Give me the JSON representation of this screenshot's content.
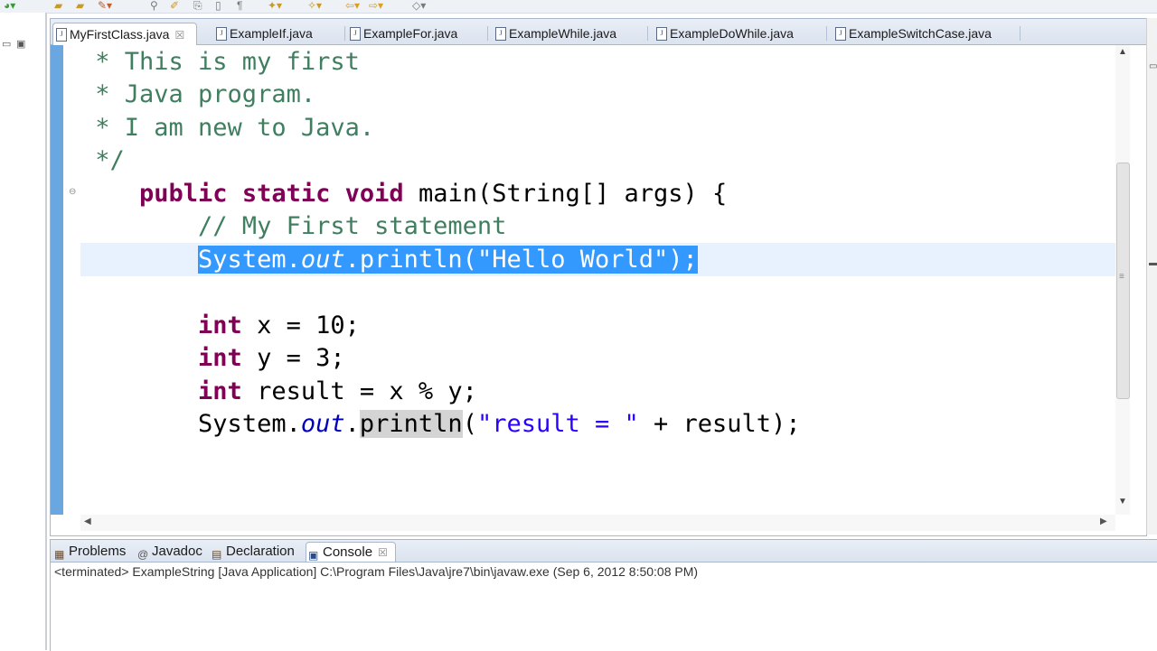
{
  "toolbar": {
    "icons": [
      "run-icon",
      "open-icon",
      "folder-icon",
      "wand-icon",
      "search-icon",
      "edit-icon",
      "paste-icon",
      "paragraph-icon",
      "nav-icon",
      "back-icon",
      "forward-icon"
    ]
  },
  "editor": {
    "tabs": [
      {
        "label": "MyFirstClass.java",
        "active": true,
        "close": "☒"
      },
      {
        "label": "ExampleIf.java"
      },
      {
        "label": "ExampleFor.java"
      },
      {
        "label": "ExampleWhile.java"
      },
      {
        "label": "ExampleDoWhile.java"
      },
      {
        "label": "ExampleSwitchCase.java"
      }
    ],
    "code": {
      "comment1": " * This is my first",
      "comment2": " * Java program.",
      "comment3": " * I am new to Java.",
      "comment4": " */",
      "main_indent": "    ",
      "kw_public": "public",
      "kw_static": "static",
      "kw_void": "void",
      "main_rest": "main(String[] args) {",
      "line_comment": "        // My First statement",
      "println1_indent": "        ",
      "println1_system": "System.",
      "println1_out": "out",
      "println1_method": ".println(",
      "println1_str": "\"Hello World\"",
      "println1_end": ");",
      "int_indent": "        ",
      "kw_int": "int",
      "decl_x": " x = 10;",
      "decl_y": " y = 3;",
      "decl_result": " result = x % y;",
      "println2_system": "System.",
      "println2_out": "out",
      "println2_dot": ".",
      "println2_method": "println",
      "println2_paren": "(",
      "println2_str": "\"result = \"",
      "println2_end": " + result);"
    }
  },
  "console": {
    "tabs": [
      {
        "label": "Problems",
        "icon": "problems-icon"
      },
      {
        "label": "Javadoc",
        "icon": "@"
      },
      {
        "label": "Declaration",
        "icon": "declaration-icon"
      },
      {
        "label": "Console",
        "icon": "console-icon",
        "active": true,
        "close": "☒"
      }
    ],
    "status": "<terminated> ExampleString [Java Application] C:\\Program Files\\Java\\jre7\\bin\\javaw.exe (Sep 6, 2012 8:50:08 PM)"
  }
}
